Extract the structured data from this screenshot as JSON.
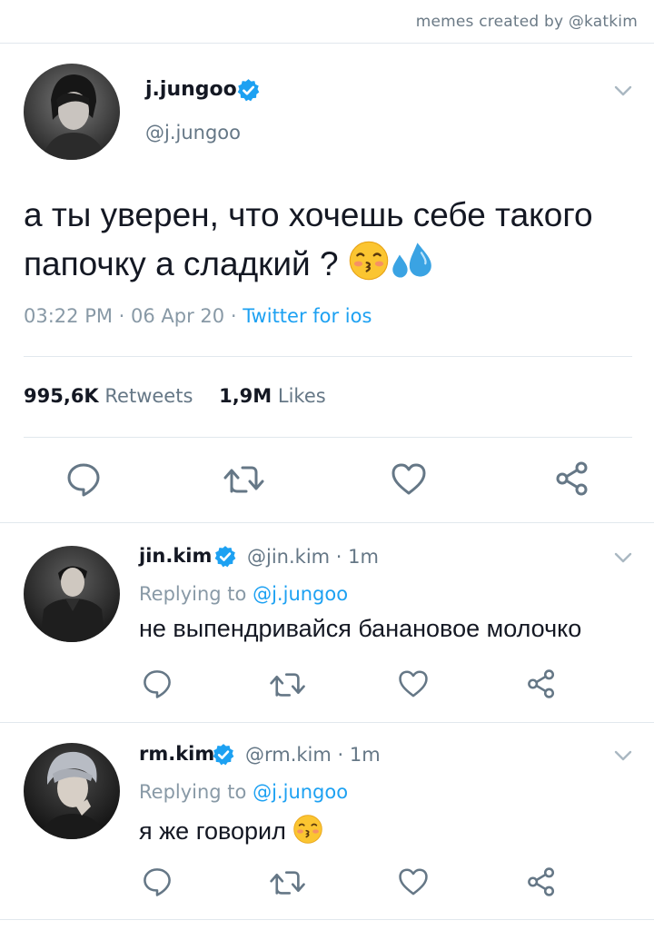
{
  "credit": "memes created by @katkim",
  "main_tweet": {
    "display_name": "j.jungoo",
    "handle": "@j.jungoo",
    "text": "а ты уверен, что хочешь себе такого папочку а сладкий ?",
    "emojis": [
      "kissing-face-emoji",
      "sweat-droplets-emoji"
    ],
    "time": "03:22 PM",
    "date": "06 Apr 20",
    "source": "Twitter for ios",
    "retweets_count": "995,6K",
    "retweets_label": "Retweets",
    "likes_count": "1,9M",
    "likes_label": "Likes"
  },
  "replies": [
    {
      "display_name": "jin.kim",
      "handle": "@jin.kim",
      "time": "1m",
      "replying_label": "Replying to",
      "replying_to": "@j.jungoo",
      "text": "не выпендривайся банановое молочко"
    },
    {
      "display_name": "rm.kim",
      "handle": "@rm.kim",
      "time": "1m",
      "replying_label": "Replying to",
      "replying_to": "@j.jungoo",
      "text": "я же говорил",
      "emoji": "kissing-face-emoji"
    }
  ],
  "icons": [
    "reply-icon",
    "retweet-icon",
    "like-icon",
    "share-icon",
    "verified-icon",
    "chevron-down-icon"
  ],
  "colors": {
    "accent": "#1da1f2",
    "secondary_text": "#657786",
    "divider": "#e1e8ed"
  }
}
